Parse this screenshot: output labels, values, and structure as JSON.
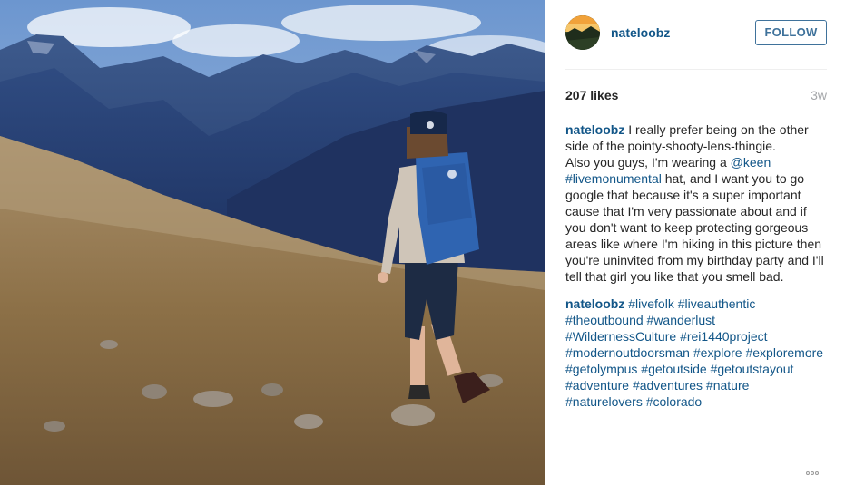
{
  "post": {
    "username": "nateloobz",
    "follow_label": "FOLLOW",
    "likes": "207 likes",
    "time_ago": "3w"
  },
  "caption": {
    "user": "nateloobz",
    "line1": " I really prefer being on the other side of the pointy-shooty-lens-thingie.",
    "p2_a": "Also you guys, I'm wearing a ",
    "mention": "@keen",
    "p2_b": " ",
    "hashtag": "#livemonumental",
    "p2_c": " hat, and I want you to go google that because it's a super important cause that I'm very passionate about and if you don't want to keep protecting gorgeous areas like where I'm hiking in this picture then you're uninvited from my birthday party and I'll tell that girl you like that you smell bad."
  },
  "comment": {
    "user": "nateloobz",
    "tags": [
      "#livefolk",
      "#liveauthentic",
      "#theoutbound",
      "#wanderlust",
      "#WildernessCulture",
      "#rei1440project",
      "#modernoutdoorsman",
      "#explore",
      "#exploremore",
      "#getolympus",
      "#getoutside",
      "#getoutstayout",
      "#adventure",
      "#adventures",
      "#nature",
      "#naturelovers",
      "#colorado"
    ]
  },
  "icons": {
    "more": "more-options-icon",
    "avatar": "profile-avatar"
  },
  "colors": {
    "link": "#125688",
    "follow": "#3f729b",
    "muted": "#a5a7aa"
  }
}
